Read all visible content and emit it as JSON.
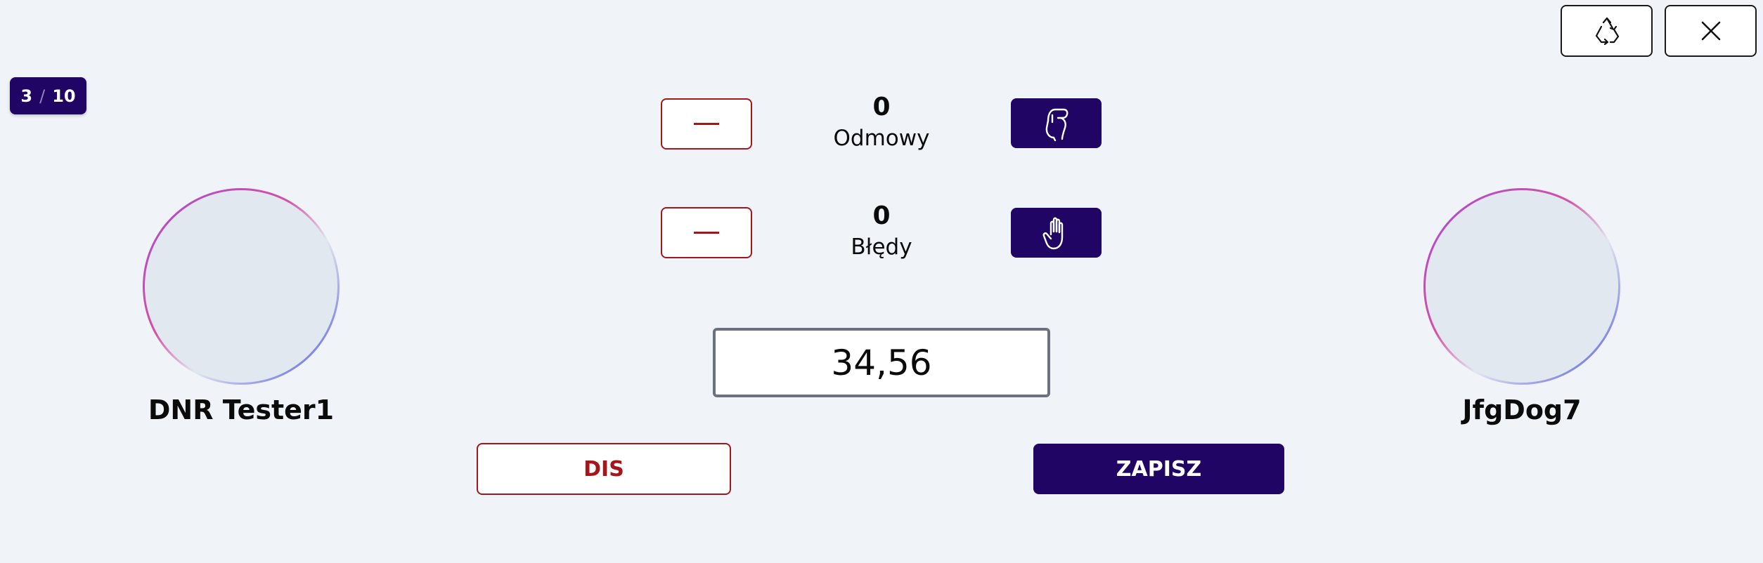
{
  "toolbar": {
    "recycle_icon": "recycle-icon",
    "close_icon": "close-icon"
  },
  "counter": {
    "current": "3",
    "separator": "/",
    "total": "10"
  },
  "stats": {
    "refusals": {
      "value": "0",
      "label": "Odmowy",
      "icon": "fist-icon"
    },
    "errors": {
      "value": "0",
      "label": "Błędy",
      "icon": "hand-icon"
    }
  },
  "time": {
    "value": "34,56"
  },
  "players": {
    "left": {
      "name": "DNR Tester1"
    },
    "right": {
      "name": "JfgDog7"
    }
  },
  "actions": {
    "dis_label": "DIS",
    "save_label": "ZAPISZ"
  },
  "colors": {
    "primary": "#200564",
    "danger": "#a3161b",
    "background": "#f0f4f9"
  }
}
